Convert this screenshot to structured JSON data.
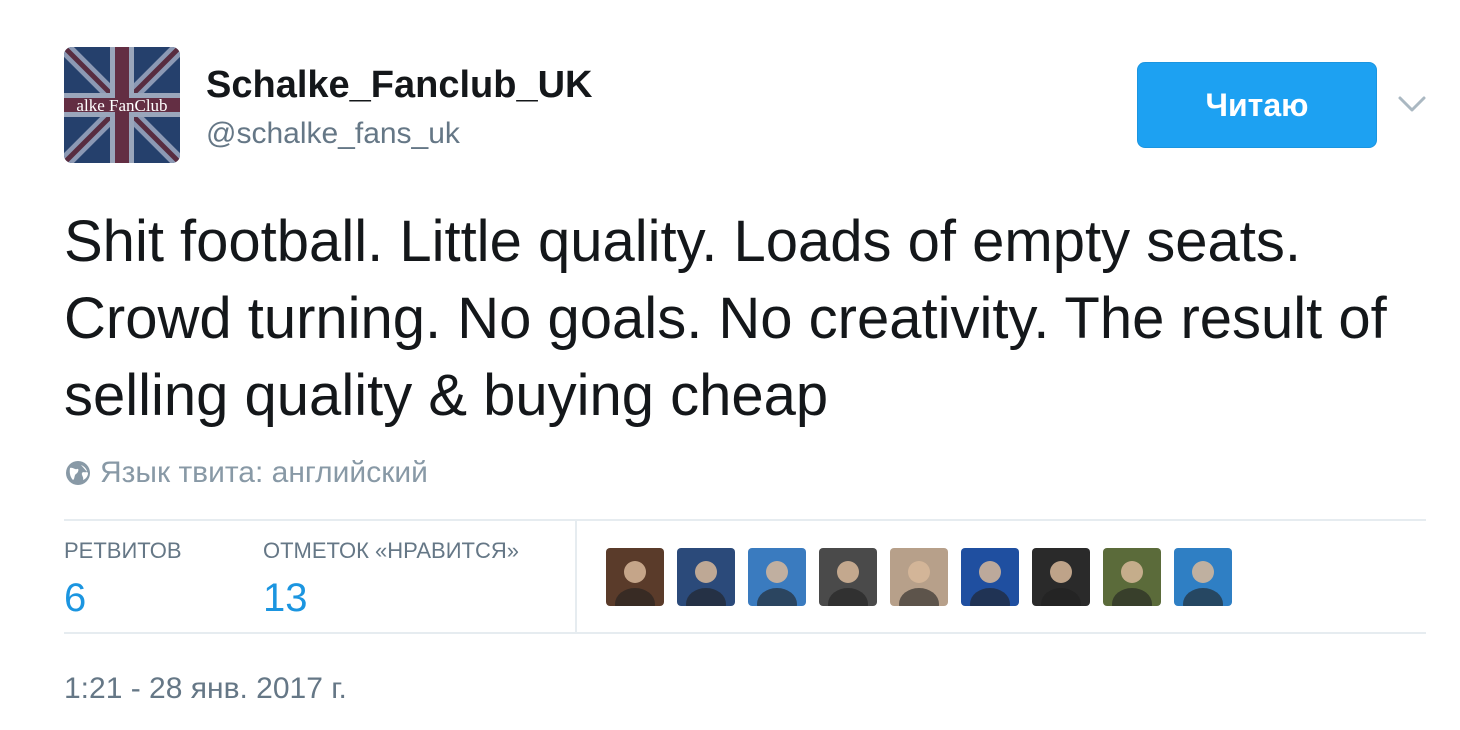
{
  "profile": {
    "display_name": "Schalke_Fanclub_UK",
    "handle": "@schalke_fans_uk",
    "avatar_text": "alke FanClub"
  },
  "follow_button": {
    "label": "Читаю",
    "color": "#1da1f2"
  },
  "menu": {
    "icon": "chevron-down-icon"
  },
  "tweet": {
    "text": "Shit football. Little quality. Loads of empty seats. Crowd turning. No goals. No creativity. The result of selling quality & buying cheap",
    "language_label": "Язык твита: английский",
    "timestamp": "1:21 - 28 янв. 2017 г."
  },
  "stats": {
    "retweets_label": "РЕТВИТОВ",
    "retweets_count": "6",
    "likes_label": "ОТМЕТОК «НРАВИТСЯ»",
    "likes_count": "13"
  },
  "likers": [
    {
      "name": "liker-avatar-1",
      "color": "#5a3b2a"
    },
    {
      "name": "liker-avatar-2",
      "color": "#2b4a7a"
    },
    {
      "name": "liker-avatar-3",
      "color": "#3a7bbf"
    },
    {
      "name": "liker-avatar-4",
      "color": "#4a4a4a"
    },
    {
      "name": "liker-avatar-5",
      "color": "#b7a08a"
    },
    {
      "name": "liker-avatar-6",
      "color": "#1f4fa0"
    },
    {
      "name": "liker-avatar-7",
      "color": "#2a2a2a"
    },
    {
      "name": "liker-avatar-8",
      "color": "#5b6b3a"
    },
    {
      "name": "liker-avatar-9",
      "color": "#2f7fc4"
    }
  ],
  "colors": {
    "accent": "#1da1f2",
    "link": "#1b95e0",
    "muted": "#657786",
    "divider": "#e6ecf0"
  }
}
